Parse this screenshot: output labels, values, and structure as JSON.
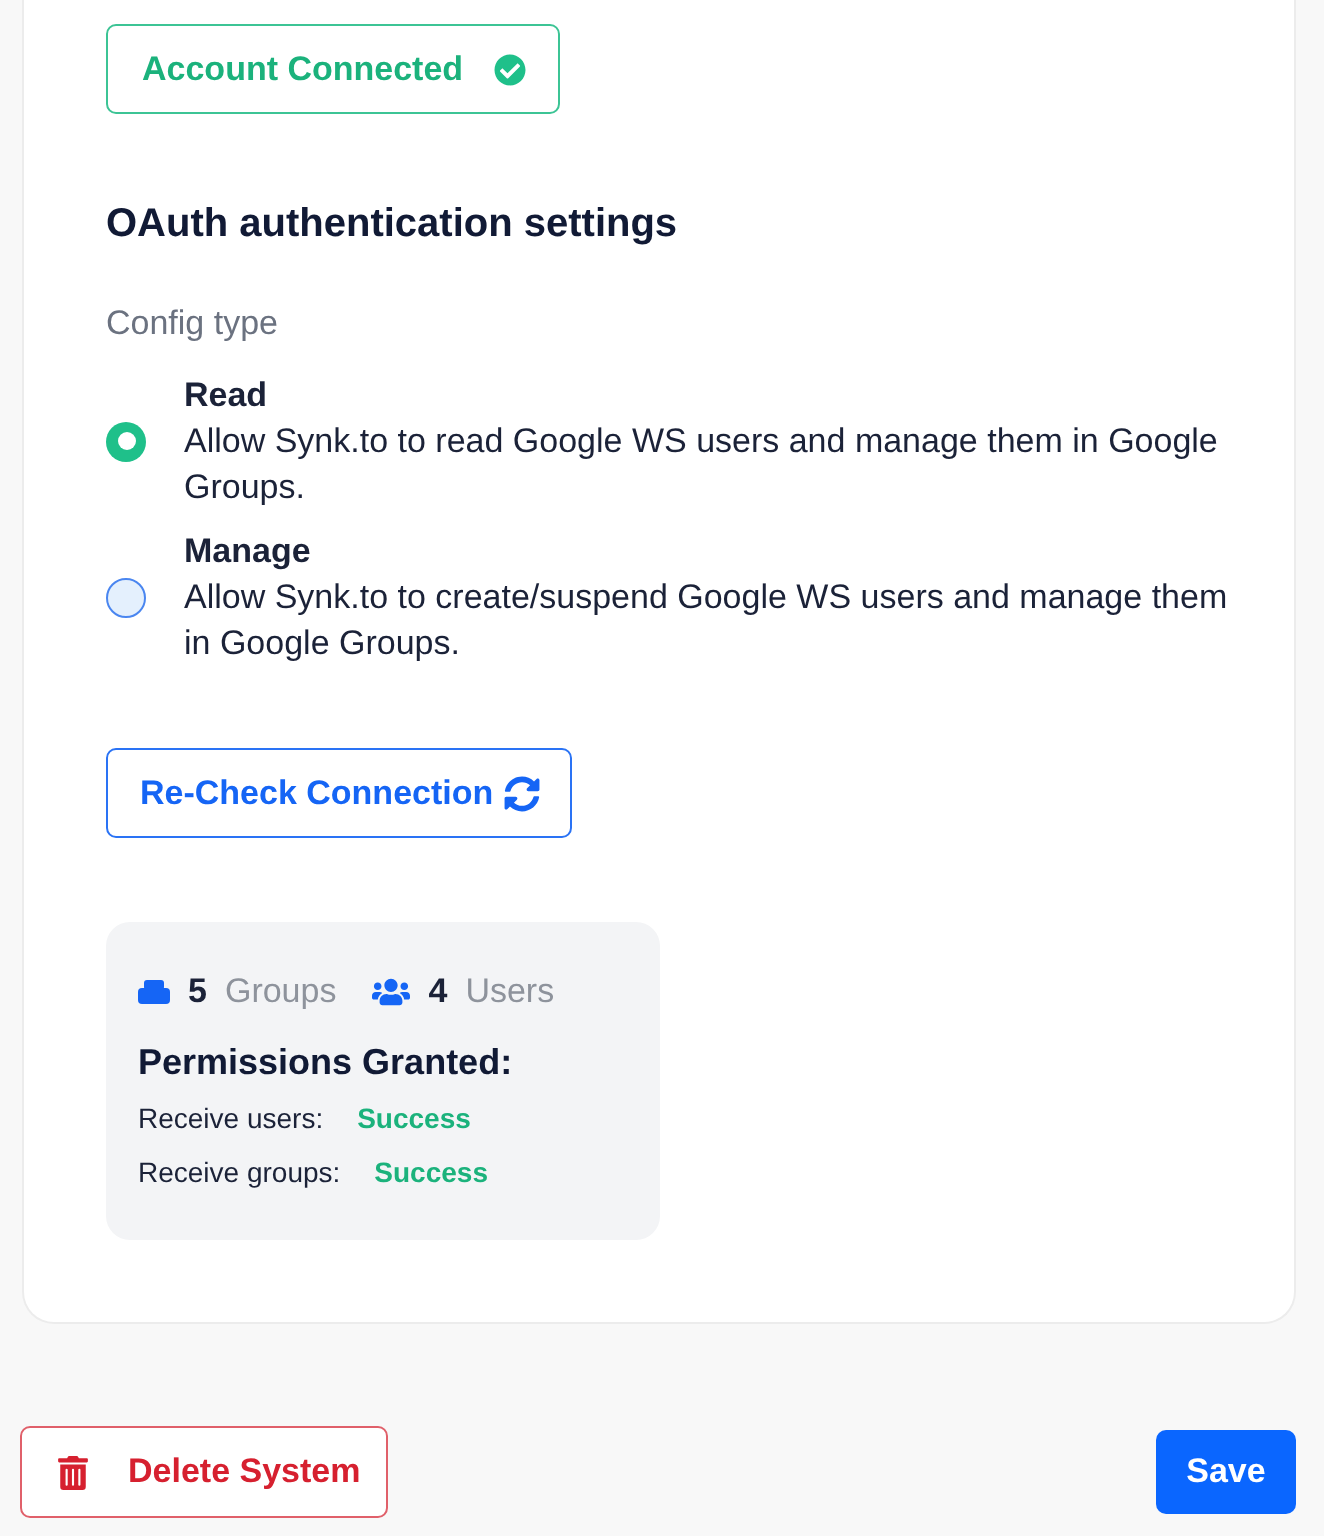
{
  "connection_status": {
    "label": "Account Connected",
    "connected": true
  },
  "auth_settings": {
    "title": "OAuth authentication settings",
    "config_label": "Config type",
    "options": [
      {
        "title": "Read",
        "description": "Allow Synk.to to read Google WS users and manage them in Google Groups.",
        "selected": true
      },
      {
        "title": "Manage",
        "description": "Allow Synk.to to create/suspend Google WS users and manage them in Google Groups.",
        "selected": false
      }
    ]
  },
  "recheck_button": {
    "label": "Re-Check Connection"
  },
  "summary": {
    "groups_count": "5",
    "groups_label": "Groups",
    "users_count": "4",
    "users_label": "Users",
    "permissions_title": "Permissions Granted:",
    "permissions": [
      {
        "label": "Receive users:",
        "status": "Success"
      },
      {
        "label": "Receive groups:",
        "status": "Success"
      }
    ]
  },
  "actions": {
    "delete_label": "Delete System",
    "save_label": "Save"
  }
}
